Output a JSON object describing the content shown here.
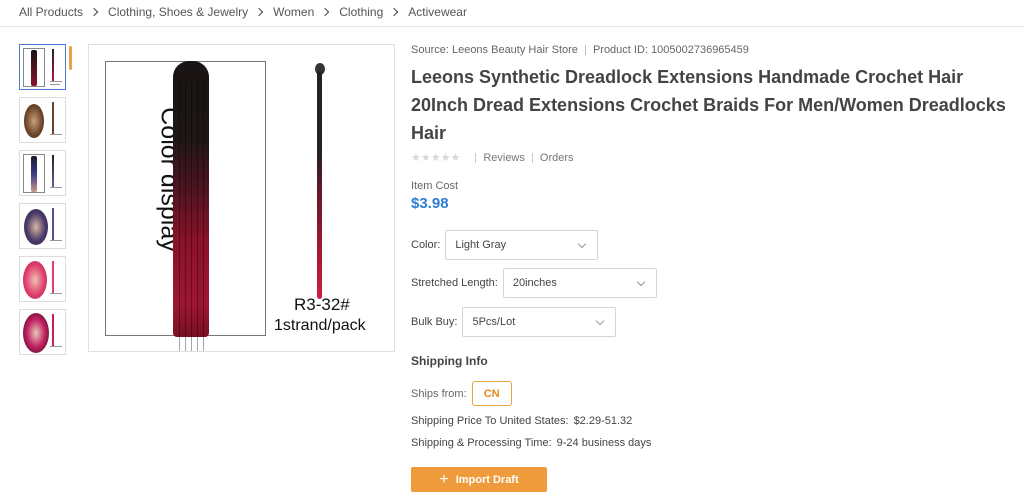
{
  "breadcrumb": [
    "All Products",
    "Clothing, Shoes & Jewelry",
    "Women",
    "Clothing",
    "Activewear"
  ],
  "product": {
    "source": "Source: Leeons Beauty Hair Store",
    "product_id": "Product ID: 1005002736965459",
    "title_lines": [
      "Leeons Synthetic Dreadlock Extensions Handmade Crochet Hair",
      "20Inch Dread Extensions Crochet Braids For Men/Women Dreadlocks",
      "Hair"
    ],
    "stars": "★★★★★",
    "reviews_label": "Reviews",
    "orders_label": "Orders",
    "item_cost_label": "Item Cost",
    "item_cost": "$3.98"
  },
  "image": {
    "label": "Color display",
    "code": "R3-32#",
    "pack": "1strand/pack"
  },
  "options": {
    "color_label": "Color:",
    "color_value": "Light Gray",
    "length_label": "Stretched Length:",
    "length_value": "20inches",
    "bulk_label": "Bulk Buy:",
    "bulk_value": "5Pcs/Lot"
  },
  "shipping": {
    "heading": "Shipping Info",
    "ships_from_label": "Ships from:",
    "ships_from_value": "CN",
    "price_label": "Shipping Price To United States:",
    "price_value": "$2.29-51.32",
    "time_label": "Shipping & Processing Time:",
    "time_value": "9-24 business days"
  },
  "actions": {
    "import_label": "Import Draft"
  },
  "colors": {
    "accent_orange": "#ef9b3c",
    "price_blue": "#2d7dd2"
  }
}
